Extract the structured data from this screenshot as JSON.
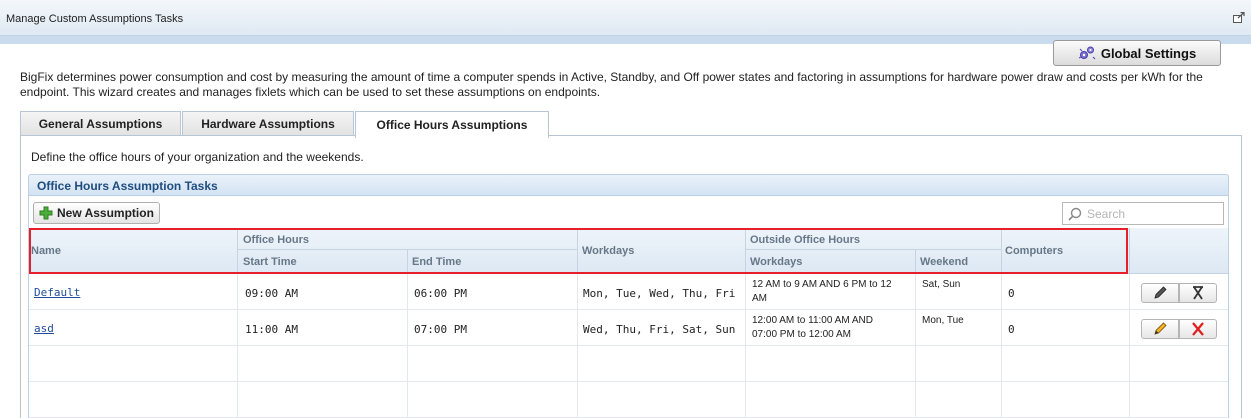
{
  "window": {
    "title": "Manage Custom Assumptions Tasks"
  },
  "toolbar": {
    "global_settings_label": "Global Settings"
  },
  "description": "BigFix determines power consumption and cost by measuring the amount of time a computer spends in Active, Standby, and Off power states and factoring in assumptions for hardware power draw and costs per kWh for the endpoint. This wizard creates and manages fixlets which can be used to set these assumptions on endpoints.",
  "tabs": [
    {
      "label": "General Assumptions",
      "active": false
    },
    {
      "label": "Hardware Assumptions",
      "active": false
    },
    {
      "label": "Office Hours Assumptions",
      "active": true
    }
  ],
  "office_hours": {
    "intro": "Define the office hours of your organization and the weekends.",
    "section_title": "Office Hours Assumption Tasks",
    "new_button_label": "New Assumption",
    "search_placeholder": "Search"
  },
  "table": {
    "headers": {
      "name": "Name",
      "office_hours": "Office Hours",
      "start_time": "Start Time",
      "end_time": "End Time",
      "workdays": "Workdays",
      "outside_office_hours": "Outside Office Hours",
      "outside_workdays": "Workdays",
      "weekend": "Weekend",
      "computers": "Computers"
    },
    "rows": [
      {
        "name": "Default",
        "start_time": "09:00 AM",
        "end_time": "06:00 PM",
        "workdays": "Mon, Tue, Wed, Thu, Fri",
        "outside_workdays_line1": "12 AM to 9 AM AND 6 PM to 12",
        "outside_workdays_line2": "AM",
        "weekend": "Sat, Sun",
        "computers": "0",
        "actions_enabled": false
      },
      {
        "name": "asd",
        "start_time": "11:00 AM",
        "end_time": "07:00 PM",
        "workdays": "Wed, Thu, Fri, Sat, Sun",
        "outside_workdays_line1": "12:00 AM to 11:00 AM AND",
        "outside_workdays_line2": "07:00 PM to 12:00 AM",
        "weekend": "Mon, Tue",
        "computers": "0",
        "actions_enabled": true
      }
    ]
  },
  "colors": {
    "highlight_box": "#e5202a",
    "delete_enabled": "#e01e1e",
    "link": "#1f4d9a"
  },
  "icons": [
    "popout-icon",
    "gear-icon",
    "add-icon",
    "search-icon",
    "edit-icon",
    "delete-icon"
  ]
}
